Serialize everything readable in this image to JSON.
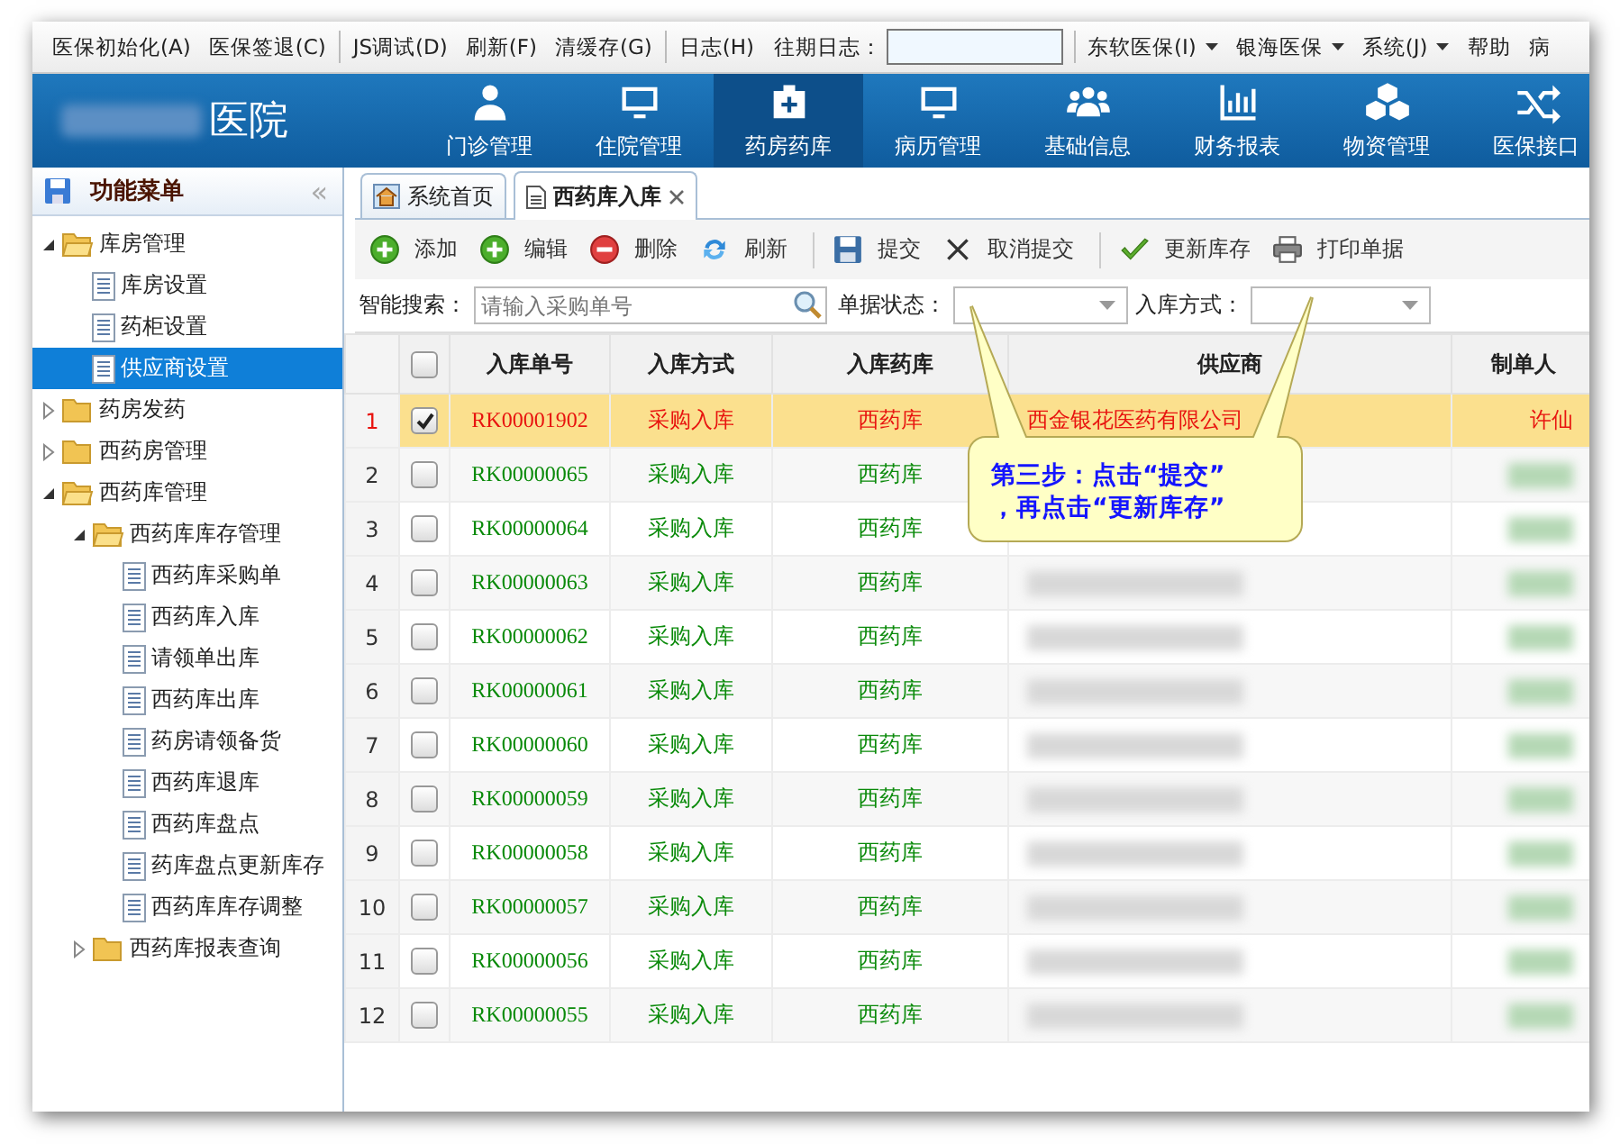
{
  "menu_bar": [
    [
      {
        "kind": "menu",
        "label": "医保初始化(A)",
        "dropdown": false
      },
      {
        "kind": "menu",
        "label": "医保签退(C)",
        "dropdown": false
      }
    ],
    [
      {
        "kind": "menu",
        "label": "JS调试(D)",
        "dropdown": false
      },
      {
        "kind": "menu",
        "label": "刷新(F)",
        "dropdown": false
      },
      {
        "kind": "menu",
        "label": "清缓存(G)",
        "dropdown": false
      }
    ],
    [
      {
        "kind": "menu",
        "label": "日志(H)",
        "dropdown": false
      },
      {
        "kind": "field",
        "label": "往期日志："
      }
    ],
    [
      {
        "kind": "menu",
        "label": "东软医保(I)",
        "dropdown": true
      },
      {
        "kind": "menu",
        "label": "银海医保",
        "dropdown": true
      },
      {
        "kind": "menu",
        "label": "系统(J)",
        "dropdown": true
      },
      {
        "kind": "menu",
        "label": "帮助",
        "dropdown": false
      },
      {
        "kind": "menu",
        "label": "病",
        "dropdown": false
      }
    ]
  ],
  "header": {
    "brand_redacted": true,
    "brand": "医院",
    "nav": [
      {
        "label": "门诊管理",
        "selected": false
      },
      {
        "label": "住院管理",
        "selected": false
      },
      {
        "label": "药房药库",
        "selected": true
      },
      {
        "label": "病历管理",
        "selected": false
      },
      {
        "label": "基础信息",
        "selected": false
      },
      {
        "label": "财务报表",
        "selected": false
      },
      {
        "label": "物资管理",
        "selected": false
      },
      {
        "label": "医保接口",
        "selected": false
      }
    ]
  },
  "sidebar": {
    "title": "功能菜单",
    "collapse": "«",
    "items": [
      {
        "kind": "folder",
        "label": "库房管理",
        "expanded": true,
        "selected": false,
        "children": [
          {
            "kind": "page",
            "label": "库房设置",
            "selected": false
          },
          {
            "kind": "page",
            "label": "药柜设置",
            "selected": false
          },
          {
            "kind": "page",
            "label": "供应商设置",
            "selected": true
          }
        ]
      },
      {
        "kind": "folder",
        "label": "药房发药",
        "expanded": false,
        "selected": false
      },
      {
        "kind": "folder",
        "label": "西药房管理",
        "expanded": false,
        "selected": false
      },
      {
        "kind": "folder",
        "label": "西药库管理",
        "expanded": true,
        "selected": false,
        "children": [
          {
            "kind": "folder",
            "label": "西药库库存管理",
            "expanded": true,
            "selected": false,
            "children": [
              {
                "kind": "page",
                "label": "西药库采购单",
                "selected": false
              },
              {
                "kind": "page",
                "label": "西药库入库",
                "selected": false
              },
              {
                "kind": "page",
                "label": "请领单出库",
                "selected": false
              },
              {
                "kind": "page",
                "label": "西药库出库",
                "selected": false
              },
              {
                "kind": "page",
                "label": "药房请领备货",
                "selected": false
              },
              {
                "kind": "page",
                "label": "西药库退库",
                "selected": false
              },
              {
                "kind": "page",
                "label": "西药库盘点",
                "selected": false
              },
              {
                "kind": "page",
                "label": "药库盘点更新库存",
                "selected": false
              },
              {
                "kind": "page",
                "label": "西药库库存调整",
                "selected": false
              }
            ]
          },
          {
            "kind": "folder",
            "label": "西药库报表查询",
            "expanded": false,
            "selected": false
          }
        ]
      }
    ]
  },
  "tabs": [
    {
      "label": "系统首页",
      "selected": false,
      "closable": false
    },
    {
      "label": "西药库入库",
      "selected": true,
      "closable": true
    }
  ],
  "toolbar": [
    [
      "添加",
      "编辑",
      "删除",
      "刷新"
    ],
    [
      "提交",
      "取消提交"
    ],
    [
      "更新库存",
      "打印单据"
    ]
  ],
  "filters": {
    "search_label": "智能搜索：",
    "search_placeholder": "请输入采购单号",
    "status_label": "单据状态：",
    "method_label": "入库方式："
  },
  "table": {
    "header_checked": false,
    "columns": [
      "入库单号",
      "入库方式",
      "入库药库",
      "供应商",
      "制单人"
    ],
    "rows": [
      {
        "no": "1",
        "selected": true,
        "checked": true,
        "order": "RK00001902",
        "method": "采购入库",
        "warehouse": "西药库",
        "supplier": "西金银花医药有限公司",
        "maker": "许仙",
        "redacted": false
      },
      {
        "no": "2",
        "selected": false,
        "checked": false,
        "order": "RK00000065",
        "method": "采购入库",
        "warehouse": "西药库",
        "redacted": true,
        "supplier_hidden": true
      },
      {
        "no": "3",
        "selected": false,
        "checked": false,
        "order": "RK00000064",
        "method": "采购入库",
        "warehouse": "西药库",
        "redacted": true,
        "supplier_hidden": true
      },
      {
        "no": "4",
        "selected": false,
        "checked": false,
        "order": "RK00000063",
        "method": "采购入库",
        "warehouse": "西药库",
        "redacted": true
      },
      {
        "no": "5",
        "selected": false,
        "checked": false,
        "order": "RK00000062",
        "method": "采购入库",
        "warehouse": "西药库",
        "redacted": true
      },
      {
        "no": "6",
        "selected": false,
        "checked": false,
        "order": "RK00000061",
        "method": "采购入库",
        "warehouse": "西药库",
        "redacted": true
      },
      {
        "no": "7",
        "selected": false,
        "checked": false,
        "order": "RK00000060",
        "method": "采购入库",
        "warehouse": "西药库",
        "redacted": true
      },
      {
        "no": "8",
        "selected": false,
        "checked": false,
        "order": "RK00000059",
        "method": "采购入库",
        "warehouse": "西药库",
        "redacted": true
      },
      {
        "no": "9",
        "selected": false,
        "checked": false,
        "order": "RK00000058",
        "method": "采购入库",
        "warehouse": "西药库",
        "redacted": true
      },
      {
        "no": "10",
        "selected": false,
        "checked": false,
        "order": "RK00000057",
        "method": "采购入库",
        "warehouse": "西药库",
        "redacted": true
      },
      {
        "no": "11",
        "selected": false,
        "checked": false,
        "order": "RK00000056",
        "method": "采购入库",
        "warehouse": "西药库",
        "redacted": true
      },
      {
        "no": "12",
        "selected": false,
        "checked": false,
        "order": "RK00000055",
        "method": "采购入库",
        "warehouse": "西药库",
        "redacted": true
      }
    ]
  },
  "callout": {
    "lines": [
      "第三步：点击“提交”",
      "，再点击“更新库存”"
    ]
  }
}
